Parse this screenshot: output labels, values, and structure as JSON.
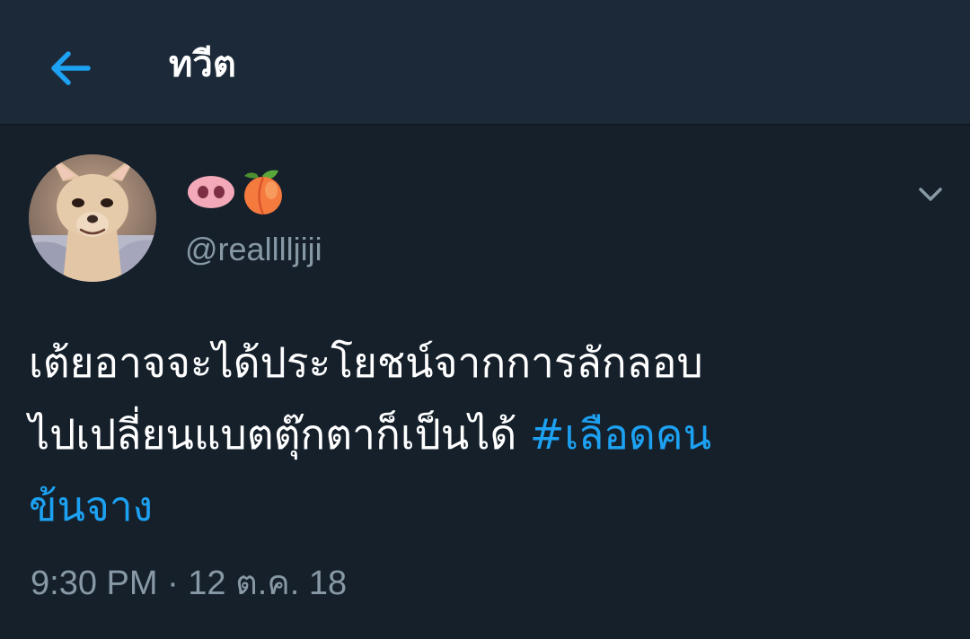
{
  "header": {
    "title": "ทวีต",
    "back_icon": "arrow-left-icon",
    "accent_color": "#1da1f2"
  },
  "tweet": {
    "display_name_icons": [
      "pig-nose-icon",
      "peach-icon"
    ],
    "handle": "@realllljiji",
    "text_main": "เต้ยอาจจะได้ประโยชน์จากการลักลอบ\nไปเปลี่ยนแบตตุ๊กตาก็เป็นได้ ",
    "hashtag_line1": "#เลือดคน",
    "hashtag_line2": "ข้นจาง",
    "timestamp": "9:30 PM · 12 ต.ค. 18",
    "menu_icon": "chevron-down-icon"
  },
  "colors": {
    "background": "#15202b",
    "header_background": "#1c2938",
    "secondary_text": "#8899a6",
    "hashtag": "#1da1f2"
  }
}
